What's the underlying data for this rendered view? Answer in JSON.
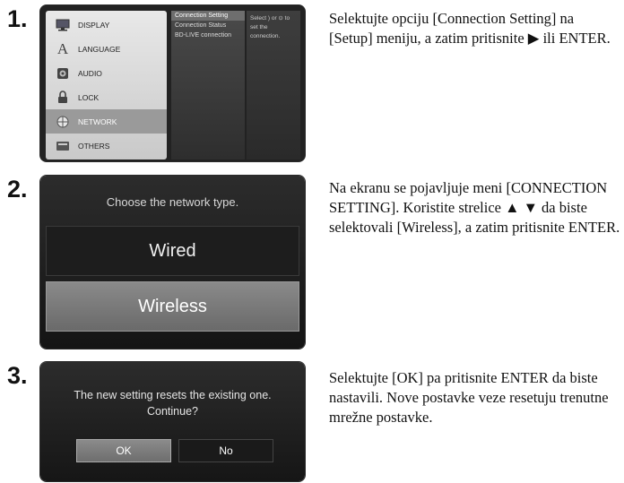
{
  "steps": [
    {
      "number": "1.",
      "description": "Selektujte opciju [Connection Setting] na [Setup] meniju, a zatim pritisnite ▶ ili ENTER."
    },
    {
      "number": "2.",
      "description": "Na ekranu se pojavljuje meni [CONNECTION SETTING]. Koristite strelice ▲ ▼ da biste selektovali [Wireless], a zatim pritisnite ENTER."
    },
    {
      "number": "3.",
      "description": "Selektujte [OK] pa pritisnite ENTER da biste nastavili. Nove postavke veze resetuju trenutne mrežne postavke."
    }
  ],
  "setup_menu": {
    "items": [
      {
        "label": "DISPLAY",
        "icon": "display-icon"
      },
      {
        "label": "LANGUAGE",
        "icon": "language-icon"
      },
      {
        "label": "AUDIO",
        "icon": "audio-icon"
      },
      {
        "label": "LOCK",
        "icon": "lock-icon"
      },
      {
        "label": "NETWORK",
        "icon": "network-icon",
        "selected": true
      },
      {
        "label": "OTHERS",
        "icon": "others-icon"
      }
    ],
    "submenu": [
      "Connection Setting",
      "Connection Status",
      "BD-LIVE connection"
    ],
    "hint": "Select ) or ⊙ to set the connection."
  },
  "network_type": {
    "title": "Choose the network type.",
    "options": [
      "Wired",
      "Wireless"
    ],
    "selected": "Wireless"
  },
  "confirm_dialog": {
    "message_line1": "The new setting resets the existing one.",
    "message_line2": "Continue?",
    "ok_label": "OK",
    "no_label": "No"
  }
}
